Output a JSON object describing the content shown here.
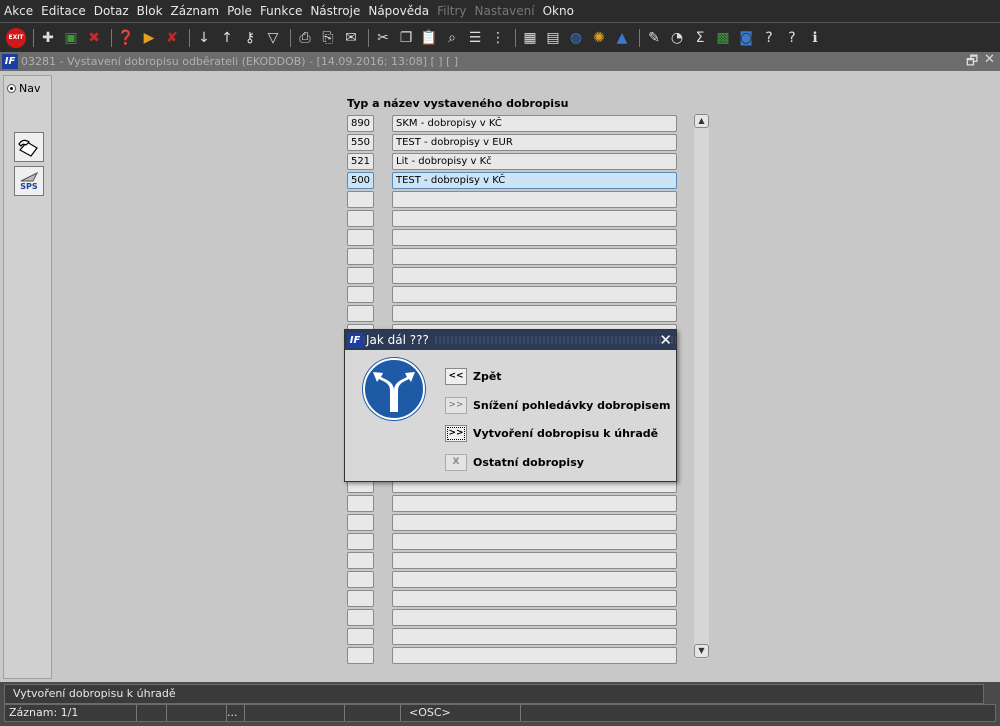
{
  "menu": [
    {
      "label": "Akce",
      "disabled": false
    },
    {
      "label": "Editace",
      "disabled": false
    },
    {
      "label": "Dotaz",
      "disabled": false
    },
    {
      "label": "Blok",
      "disabled": false
    },
    {
      "label": "Záznam",
      "disabled": false
    },
    {
      "label": "Pole",
      "disabled": false
    },
    {
      "label": "Funkce",
      "disabled": false
    },
    {
      "label": "Nástroje",
      "disabled": false
    },
    {
      "label": "Nápověda",
      "disabled": false
    },
    {
      "label": "Filtry",
      "disabled": true
    },
    {
      "label": "Nastavení",
      "disabled": true
    },
    {
      "label": "Okno",
      "disabled": false
    }
  ],
  "toolbar": {
    "exit_label": "EXIT",
    "icons": [
      "exit-icon",
      "sep",
      "insert-record-icon",
      "add-record-icon",
      "delete-record-icon",
      "sep",
      "query-icon",
      "query-run-icon",
      "query-cancel-icon",
      "sep",
      "sort-asc-icon",
      "sort-desc-icon",
      "key-icon",
      "filter-icon",
      "sep",
      "print-icon",
      "print-preview-icon",
      "mail-icon",
      "sep",
      "cut-icon",
      "copy-icon",
      "paste-icon",
      "zoom-icon",
      "list-icon",
      "tree-icon",
      "sep",
      "calendar-icon",
      "doc-icon",
      "globe-icon",
      "star-icon",
      "warning-icon",
      "sep",
      "editor-icon",
      "clock-icon",
      "sum-icon",
      "excel-icon",
      "note-icon",
      "help-key-icon",
      "help-icon",
      "info-icon"
    ]
  },
  "window": {
    "title": "03281 - Vystavení dobropisu odběrateli (EKODDOB) - [14.09.2016; 13:08] [ ] [ ]",
    "logo": "IF",
    "restore": "🗗",
    "close": "✕"
  },
  "sidebar": {
    "nav_label": "Nav",
    "btn2_label": "SPS"
  },
  "list": {
    "header": "Typ a název vystaveného dobropisu",
    "rows": [
      {
        "code": "890",
        "name": "SKM - dobropisy v KČ"
      },
      {
        "code": "550",
        "name": "TEST - dobropisy v EUR"
      },
      {
        "code": "521",
        "name": "Lit - dobropisy v Kč"
      },
      {
        "code": "500",
        "name": "TEST - dobropisy v KČ"
      }
    ],
    "selected_index": 3,
    "total_rows": 29
  },
  "dialog": {
    "title": "Jak dál ???",
    "logo": "IF",
    "close": "✕",
    "options": [
      {
        "btn": "<<",
        "label": "Zpět",
        "disabled": false,
        "focused": false
      },
      {
        "btn": ">>",
        "label": "Snížení pohledávky dobropisem",
        "disabled": true,
        "focused": false
      },
      {
        "btn": ">>",
        "label": "Vytvoření dobropisu k úhradě",
        "disabled": false,
        "focused": true
      },
      {
        "btn": "X",
        "label": "Ostatní dobropisy",
        "disabled": true,
        "focused": false
      }
    ]
  },
  "status": {
    "message": "Vytvoření dobropisu k úhradě",
    "record": "Záznam: 1/1",
    "ellipsis": "...",
    "mode": "<OSC>"
  },
  "scroll": {
    "up": "▲",
    "down": "▼"
  }
}
